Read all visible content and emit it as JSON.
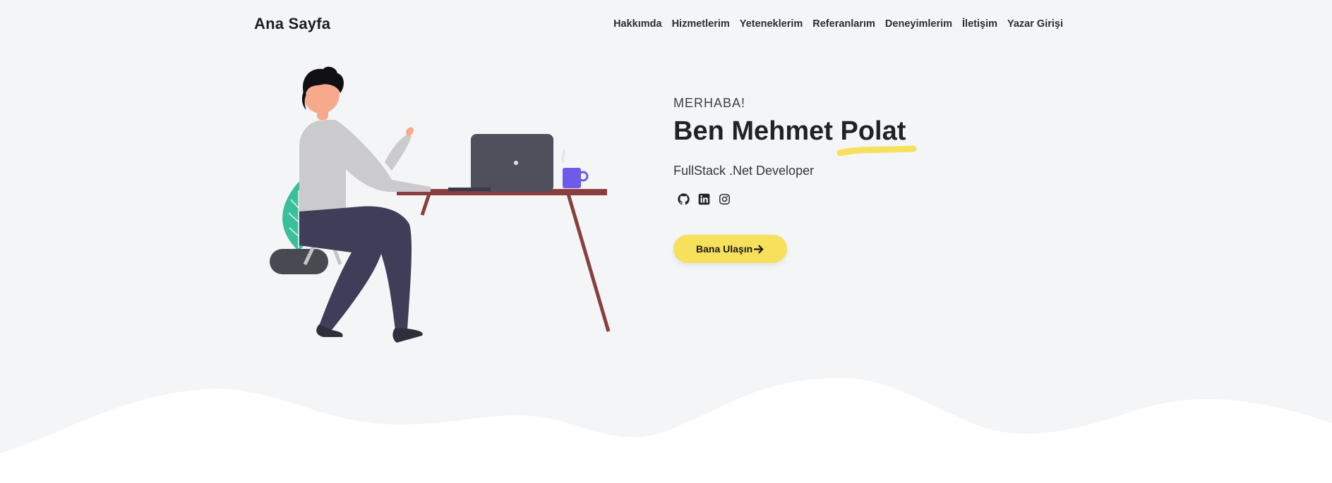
{
  "nav": {
    "brand": "Ana Sayfa",
    "links": [
      "Hakkımda",
      "Hizmetlerim",
      "Yeteneklerim",
      "Referanlarım",
      "Deneyimlerim",
      "İletişim",
      "Yazar Girişi"
    ]
  },
  "hero": {
    "greeting": "MERHABA!",
    "name": "Ben Mehmet Polat",
    "role": "FullStack .Net Developer",
    "socials": [
      {
        "icon": "github-icon"
      },
      {
        "icon": "linkedin-icon"
      },
      {
        "icon": "instagram-icon"
      }
    ],
    "cta": {
      "label": "Bana Ulaşın",
      "icon": "arrow-right-icon"
    }
  },
  "colors": {
    "background": "#f4f5f7",
    "accent_yellow": "#f7e05c",
    "text_dark": "#1f2227"
  }
}
